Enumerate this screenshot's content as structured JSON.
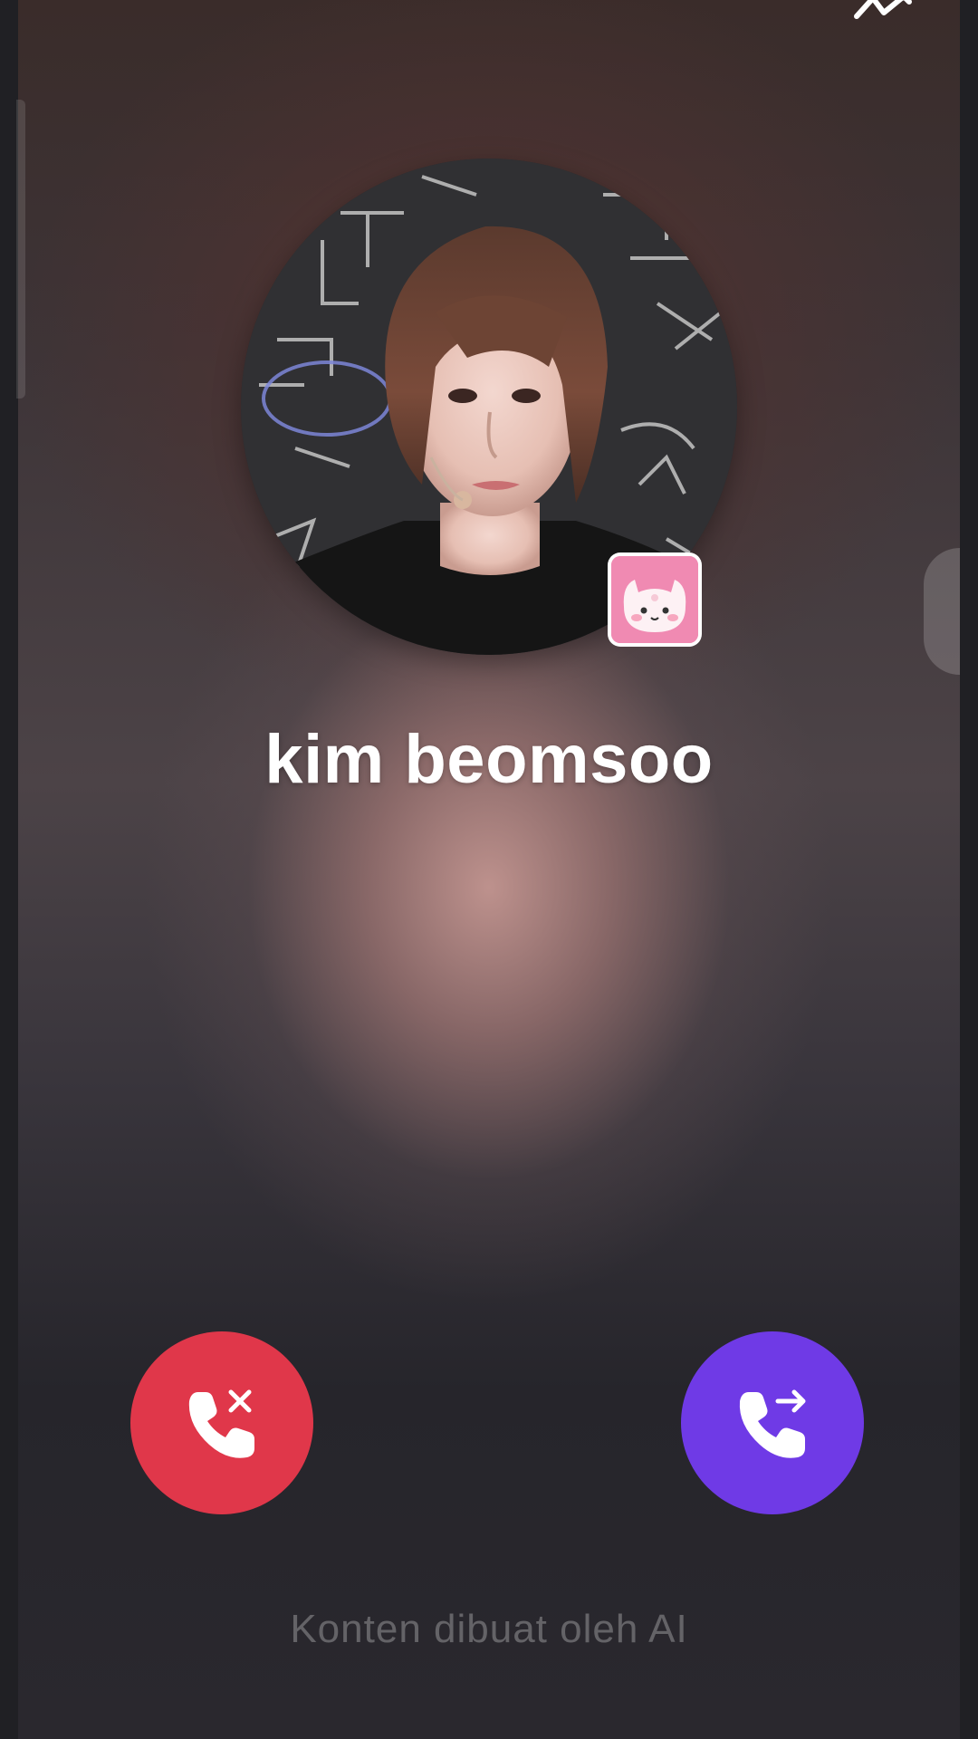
{
  "caller": {
    "name": "kim beomsoo",
    "avatar_icon": "person-photo",
    "badge_icon": "pink-cat-sticker"
  },
  "actions": {
    "decline_icon": "phone-decline-icon",
    "decline_color": "#e0374a",
    "accept_icon": "phone-forward-icon",
    "accept_color": "#6f3ae6"
  },
  "footer": {
    "note": "Konten dibuat oleh AI"
  },
  "top_bar": {
    "corner_icon": "chevron-icon"
  }
}
